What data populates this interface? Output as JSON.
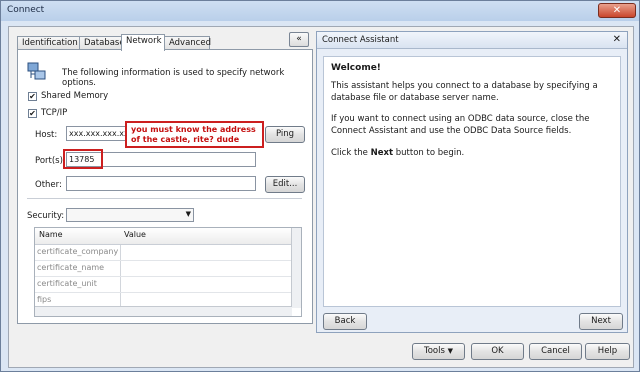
{
  "window": {
    "title": "Connect",
    "close_glyph": "✕"
  },
  "tabs": [
    {
      "label": "Identification"
    },
    {
      "label": "Database"
    },
    {
      "label": "Network"
    },
    {
      "label": "Advanced"
    }
  ],
  "collapse_glyph": "«",
  "network": {
    "info_text": "The following information is used to specify network options.",
    "shared_memory": {
      "label": "Shared Memory",
      "checked": true
    },
    "tcpip": {
      "label": "TCP/IP",
      "checked": true
    },
    "host": {
      "label": "Host:",
      "value": "xxx.xxx.xxx.xxx"
    },
    "ping_label": "Ping",
    "port": {
      "label": "Port(s):",
      "value": "13785"
    },
    "other": {
      "label": "Other:",
      "value": ""
    },
    "edit_label": "Edit...",
    "security": {
      "label": "Security:",
      "value": ""
    },
    "table": {
      "columns": [
        "Name",
        "Value"
      ],
      "rows": [
        {
          "name": "certificate_company",
          "value": ""
        },
        {
          "name": "certificate_name",
          "value": ""
        },
        {
          "name": "certificate_unit",
          "value": ""
        },
        {
          "name": "fips",
          "value": ""
        }
      ]
    }
  },
  "annotation": {
    "text": "you must know the address of the castle, rite? dude"
  },
  "assistant": {
    "title": "Connect Assistant",
    "close_glyph": "✕",
    "welcome": "Welcome!",
    "para1": "This assistant helps you connect to a database by specifying a database file or database server name.",
    "para2": "If you want to connect using an ODBC data source, close the Connect Assistant and use the ODBC Data Source fields.",
    "para3_pre": "Click the ",
    "para3_bold": "Next",
    "para3_post": " button to begin.",
    "back_label": "Back",
    "next_label": "Next"
  },
  "footer": {
    "tools_label": "Tools",
    "ok_label": "OK",
    "cancel_label": "Cancel",
    "help_label": "Help"
  }
}
